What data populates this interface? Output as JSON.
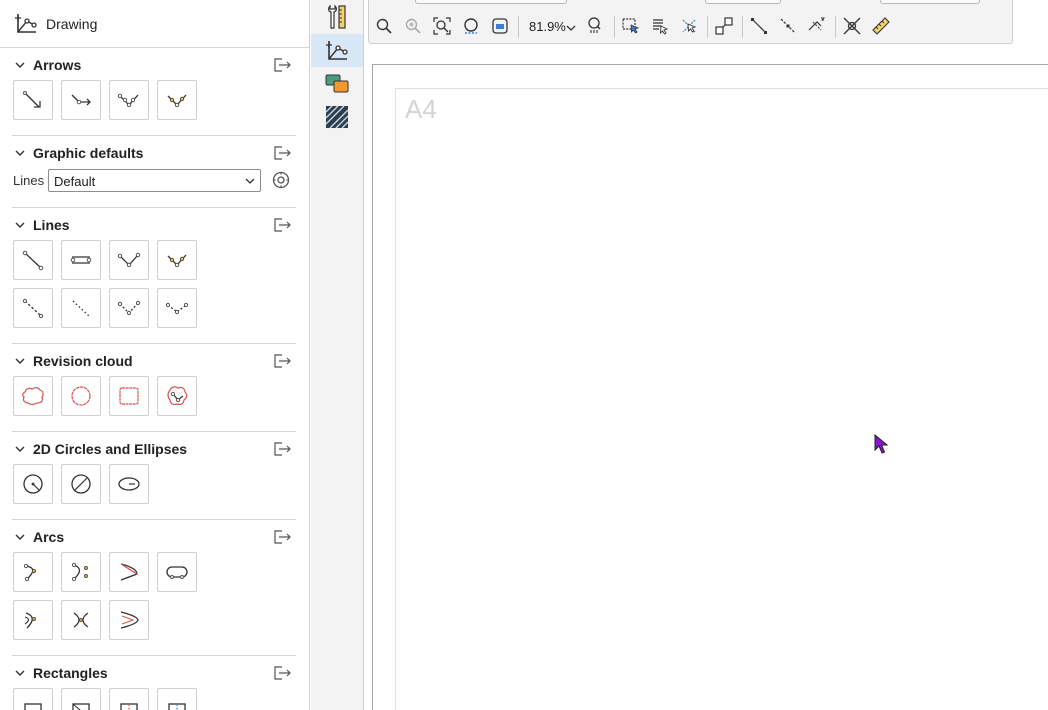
{
  "panel": {
    "title": "Drawing",
    "sections": {
      "arrows": "Arrows",
      "graphic_defaults": "Graphic defaults",
      "lines": "Lines",
      "revision_cloud": "Revision cloud",
      "circles": "2D Circles and Ellipses",
      "arcs": "Arcs",
      "rectangles": "Rectangles"
    },
    "graphic_defaults": {
      "lines_label": "Lines",
      "lines_value": "Default"
    }
  },
  "toolbar": {
    "zoom_level": "81.9%"
  },
  "canvas": {
    "page_label": "A4"
  },
  "colors": {
    "active_tab": "#d9e8f6",
    "cloud_red": "#d9534f",
    "node_yellow": "#e9c21d",
    "cursor": "#8a14c8"
  }
}
